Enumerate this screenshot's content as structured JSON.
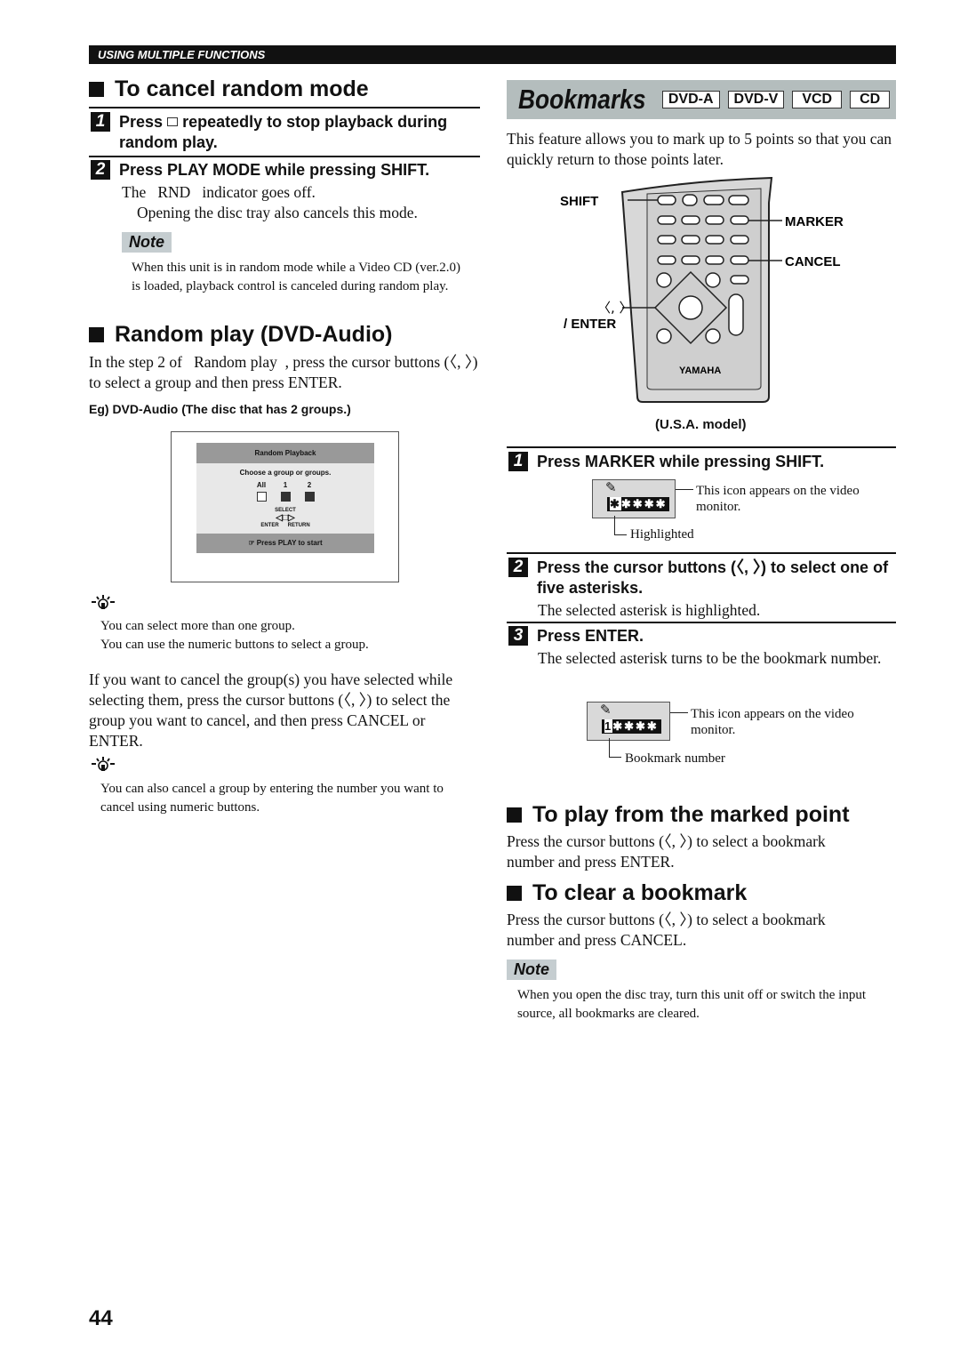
{
  "header": {
    "section": "USING MULTIPLE FUNCTIONS"
  },
  "cancel_random": {
    "title": "To cancel random mode",
    "step1": {
      "num": "1",
      "pre": "Press",
      "icon": "stop-icon",
      "post": "repeatedly to stop playback during random play."
    },
    "step2": {
      "num": "2",
      "text": "Press PLAY MODE while pressing SHIFT.",
      "desc1": "The   RND   indicator goes off.",
      "desc2": "Opening the disc tray also cancels this mode."
    },
    "note_label": "Note",
    "note": "When this unit is in random mode while a Video CD (ver.2.0) is loaded, playback control is canceled during random play."
  },
  "random_dvd_audio": {
    "title": "Random play (DVD-Audio)",
    "intro": "In the step 2 of   Random play  , press the cursor buttons (〈, 〉) to select a group and then press ENTER.",
    "example": "Eg) DVD-Audio (The disc that has 2 groups.)",
    "screen": {
      "title": "Random Playback",
      "prompt": "Choose a group or groups.",
      "groups": [
        "All",
        "1",
        "2"
      ],
      "select": "SELECT",
      "enter": "ENTER",
      "return": "RETURN",
      "footer": "Press PLAY to start"
    },
    "tip1": [
      "You can select more than one group.",
      "You can use the numeric buttons to select a group."
    ],
    "para": "If you want to cancel the group(s) you have selected while selecting them, press the cursor buttons (〈, 〉) to select the group you want to cancel, and then press CANCEL or ENTER.",
    "tip2": "You can also cancel a group by entering the number you want to cancel using numeric buttons."
  },
  "bookmarks": {
    "title": "Bookmarks",
    "badges": [
      "DVD-A",
      "DVD-V",
      "VCD",
      "CD"
    ],
    "intro": "This feature allows you to mark up to 5 points so that you can quickly return to those points later.",
    "remote": {
      "shift": "SHIFT",
      "marker": "MARKER",
      "cancel": "CANCEL",
      "cursor": "〈, 〉",
      "enter": "/ ENTER",
      "brand": "YAMAHA",
      "model": "(U.S.A. model)"
    },
    "step1": {
      "num": "1",
      "text": "Press MARKER while pressing SHIFT.",
      "callout": "This icon appears on the video monitor.",
      "osd_hl": "✱",
      "osd_rest": "✱✱✱✱",
      "highlight": "Highlighted"
    },
    "step2": {
      "num": "2",
      "text": "Press the cursor buttons (〈, 〉) to select one of five asterisks.",
      "desc": "The selected asterisk is highlighted."
    },
    "step3": {
      "num": "3",
      "text": "Press ENTER.",
      "desc": "The selected asterisk turns to be the bookmark number.",
      "callout": "This icon appears on the video monitor.",
      "osd_hl": "1",
      "osd_rest": "✱✱✱✱",
      "numlabel": "Bookmark number"
    }
  },
  "play_marked": {
    "title": "To play from the marked point",
    "text": "Press the cursor buttons (〈, 〉) to select a bookmark number and press ENTER."
  },
  "clear": {
    "title": "To clear a bookmark",
    "text": "Press the cursor buttons (〈, 〉) to select a bookmark number and press CANCEL.",
    "note_label": "Note",
    "note": "When you open the disc tray, turn this unit off or switch the input source, all bookmarks are cleared."
  },
  "page_number": "44"
}
